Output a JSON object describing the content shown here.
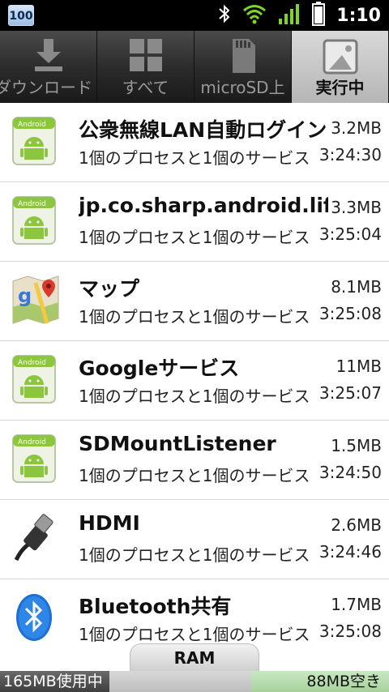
{
  "status_bar": {
    "notification_badge": "100",
    "time": "1:10",
    "icons": [
      "bluetooth-icon",
      "wifi-icon",
      "signal-icon",
      "battery-icon"
    ]
  },
  "tabs": [
    {
      "label": "ダウンロード",
      "icon": "download-icon",
      "active": false
    },
    {
      "label": "すべて",
      "icon": "grid-icon",
      "active": false
    },
    {
      "label": "microSD上",
      "icon": "sdcard-icon",
      "active": false
    },
    {
      "label": "実行中",
      "icon": "running-icon",
      "active": true
    }
  ],
  "apps": [
    {
      "name": "公衆無線LAN自動ログイン",
      "size": "3.2MB",
      "desc": "1個のプロセスと1個のサービス",
      "time": "3:24:30",
      "icon": "android-app-icon"
    },
    {
      "name": "jp.co.sharp.android.lifelog",
      "size": "3.3MB",
      "desc": "1個のプロセスと1個のサービス",
      "time": "3:25:04",
      "icon": "android-app-icon"
    },
    {
      "name": "マップ",
      "size": "8.1MB",
      "desc": "1個のプロセスと1個のサービス",
      "time": "3:25:08",
      "icon": "maps-icon"
    },
    {
      "name": "Googleサービス",
      "size": "11MB",
      "desc": "1個のプロセスと1個のサービス",
      "time": "3:25:07",
      "icon": "android-app-icon"
    },
    {
      "name": "SDMountListener",
      "size": "1.5MB",
      "desc": "1個のプロセスと1個のサービス",
      "time": "3:24:50",
      "icon": "android-app-icon"
    },
    {
      "name": "HDMI",
      "size": "2.6MB",
      "desc": "1個のプロセスと1個のサービス",
      "time": "3:24:46",
      "icon": "hdmi-cable-icon"
    },
    {
      "name": "Bluetooth共有",
      "size": "1.7MB",
      "desc": "1個のプロセスと1個のサービス",
      "time": "3:25:08",
      "icon": "bluetooth-app-icon"
    }
  ],
  "ram": {
    "label": "RAM",
    "used": "165MB使用中",
    "free": "88MB空き"
  }
}
